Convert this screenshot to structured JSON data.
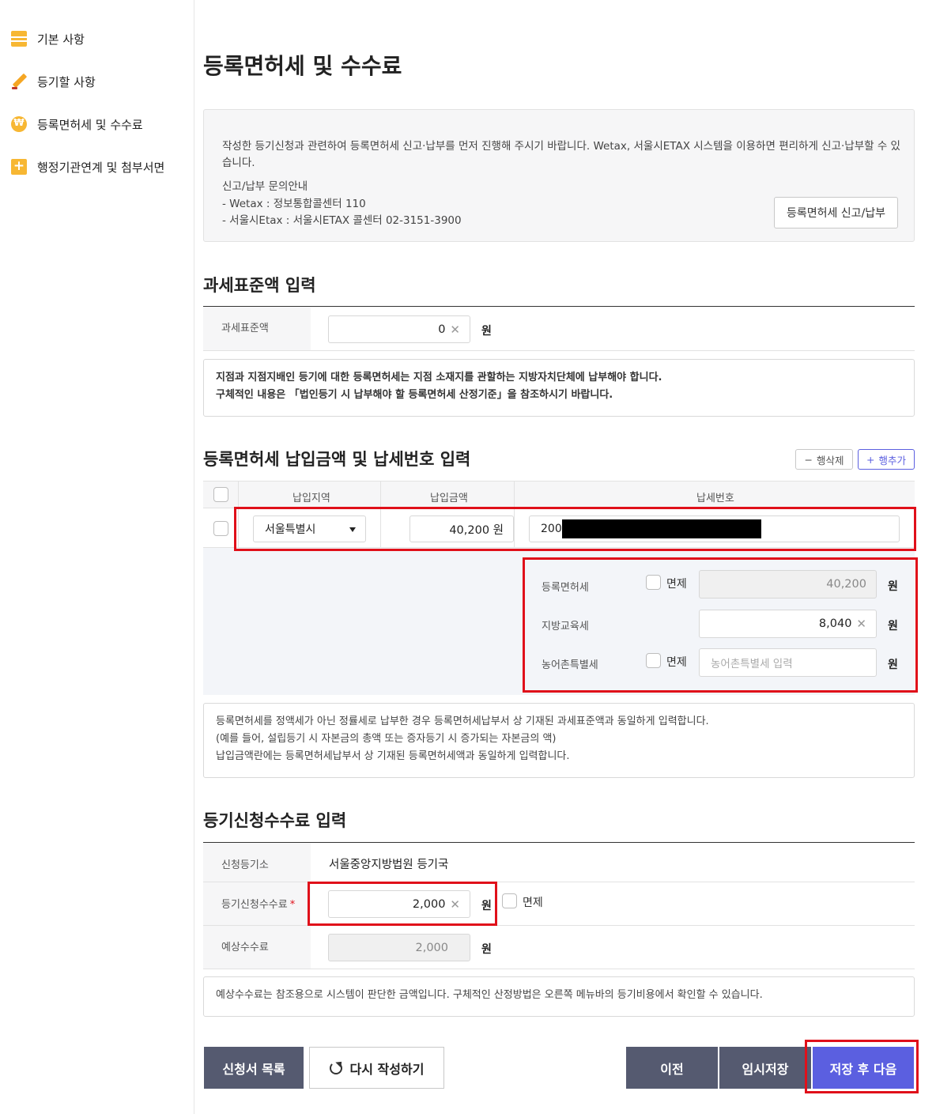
{
  "sidebar": {
    "items": [
      {
        "label": "기본 사항",
        "icon": "document-icon"
      },
      {
        "label": "등기할 사항",
        "icon": "pencil-icon"
      },
      {
        "label": "등록면허세 및 수수료",
        "icon": "won-coin-icon"
      },
      {
        "label": "행정기관연계 및 첨부서면",
        "icon": "plus-icon"
      }
    ]
  },
  "page": {
    "title": "등록면허세 및 수수료"
  },
  "notice": {
    "text": "작성한 등기신청과 관련하여 등록면허세 신고·납부를 먼저 진행해 주시기 바랍니다. Wetax, 서울시ETAX 시스템을 이용하면 편리하게 신고·납부할 수 있습니다.",
    "contact_title": "신고/납부 문의안내",
    "contact_wetax": "- Wetax : 정보통합콜센터 110",
    "contact_etax": "- 서울시Etax : 서울시ETAX 콜센터 02-3151-3900",
    "button": "등록면허세 신고/납부"
  },
  "tax_base": {
    "section_title": "과세표준액 입력",
    "label": "과세표준액",
    "value": "0",
    "unit": "원",
    "info_line1": "지점과 지점지배인 등기에 대한 등록면허세는 지점 소재지를 관할하는 지방자치단체에 납부해야 합니다.",
    "info_line2": "구체적인 내용은 「법인등기 시 납부해야 할 등록면허세 산정기준」을 참조하시기 바랍니다."
  },
  "payment": {
    "section_title": "등록면허세 납입금액 및 납세번호 입력",
    "delete_row": "행삭제",
    "add_row": "행추가",
    "columns": [
      "납입지역",
      "납입금액",
      "납세번호"
    ],
    "row": {
      "region": "서울특별시",
      "amount": "40,200 원",
      "tax_number": "200-"
    },
    "details": {
      "reg_tax_label": "등록면허세",
      "reg_tax_exempt": "면제",
      "reg_tax_value": "40,200",
      "edu_tax_label": "지방교육세",
      "edu_tax_value": "8,040",
      "rural_tax_label": "농어촌특별세",
      "rural_tax_exempt": "면제",
      "rural_tax_placeholder": "농어촌특별세 입력",
      "unit": "원"
    },
    "info_line1": "등록면허세를 정액세가 아닌 정률세로 납부한 경우 등록면허세납부서 상 기재된 과세표준액과 동일하게 입력합니다.",
    "info_line2": "(예를 들어, 설립등기 시 자본금의 총액 또는 증자등기 시 증가되는 자본금의 액)",
    "info_line3": "납입금액란에는 등록면허세납부서 상 기재된 등록면허세액과 동일하게 입력합니다."
  },
  "fee": {
    "section_title": "등기신청수수료 입력",
    "office_label": "신청등기소",
    "office_value": "서울중앙지방법원 등기국",
    "fee_label": "등기신청수수료",
    "required_mark": "*",
    "fee_value": "2,000",
    "exempt": "면제",
    "expected_label": "예상수수료",
    "expected_value": "2,000",
    "unit": "원",
    "info": "예상수수료는 참조용으로 시스템이 판단한 금액입니다. 구체적인 산정방법은 오른쪽 메뉴바의 등기비용에서 확인할 수 있습니다."
  },
  "footer": {
    "list_button": "신청서 목록",
    "rewrite_button": "다시 작성하기",
    "prev_button": "이전",
    "temp_save_button": "임시저장",
    "save_next_button": "저장 후 다음"
  },
  "colors": {
    "accent": "#f7b733",
    "primary": "#5b5fe0",
    "dark_button": "#555a70",
    "highlight": "#e0101a"
  }
}
